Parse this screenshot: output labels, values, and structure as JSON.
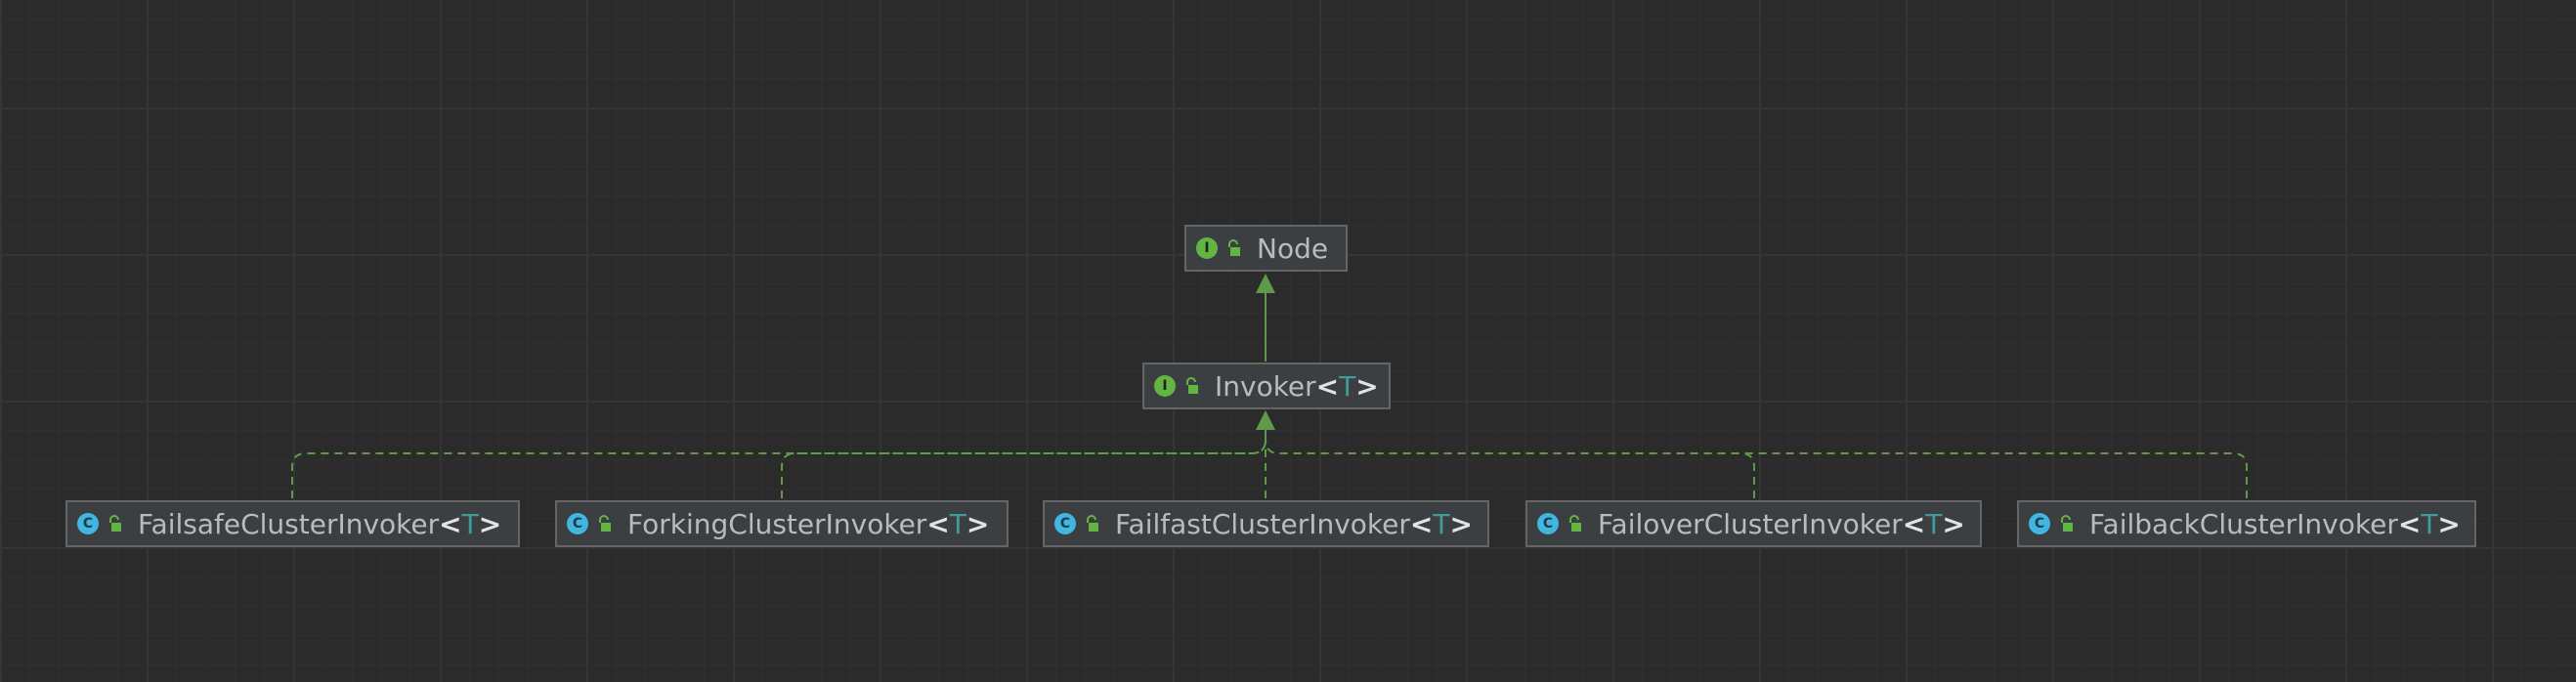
{
  "diagram": {
    "nodes": [
      {
        "id": "node",
        "kind": "interface",
        "badge": "I",
        "name": "Node",
        "type_param": ""
      },
      {
        "id": "invoker",
        "kind": "interface",
        "badge": "I",
        "name": "Invoker",
        "type_param": "T"
      },
      {
        "id": "failsafe",
        "kind": "class",
        "badge": "C",
        "name": "FailsafeClusterInvoker",
        "type_param": "T"
      },
      {
        "id": "forking",
        "kind": "class",
        "badge": "C",
        "name": "ForkingClusterInvoker",
        "type_param": "T"
      },
      {
        "id": "failfast",
        "kind": "class",
        "badge": "C",
        "name": "FailfastClusterInvoker",
        "type_param": "T"
      },
      {
        "id": "failover",
        "kind": "class",
        "badge": "C",
        "name": "FailoverClusterInvoker",
        "type_param": "T"
      },
      {
        "id": "failback",
        "kind": "class",
        "badge": "C",
        "name": "FailbackClusterInvoker",
        "type_param": "T"
      }
    ],
    "edges": [
      {
        "from": "invoker",
        "to": "node",
        "type": "extends",
        "style": "solid"
      },
      {
        "from": "failsafe",
        "to": "invoker",
        "type": "implements",
        "style": "dashed"
      },
      {
        "from": "forking",
        "to": "invoker",
        "type": "implements",
        "style": "dashed"
      },
      {
        "from": "failfast",
        "to": "invoker",
        "type": "implements",
        "style": "dashed"
      },
      {
        "from": "failover",
        "to": "invoker",
        "type": "implements",
        "style": "dashed"
      },
      {
        "from": "failback",
        "to": "invoker",
        "type": "implements",
        "style": "dashed"
      }
    ],
    "colors": {
      "background": "#2b2b2b",
      "node_fill": "#3c3f41",
      "node_border": "#656565",
      "edge": "#5f9a4a",
      "interface_badge": "#62b543",
      "class_badge": "#40b6e0",
      "type_param": "#3f9c9c",
      "text": "#bbbbbb"
    },
    "icons": {
      "interface": "interface-badge-icon",
      "class": "class-badge-icon",
      "visibility": "public-unlock-icon"
    }
  }
}
